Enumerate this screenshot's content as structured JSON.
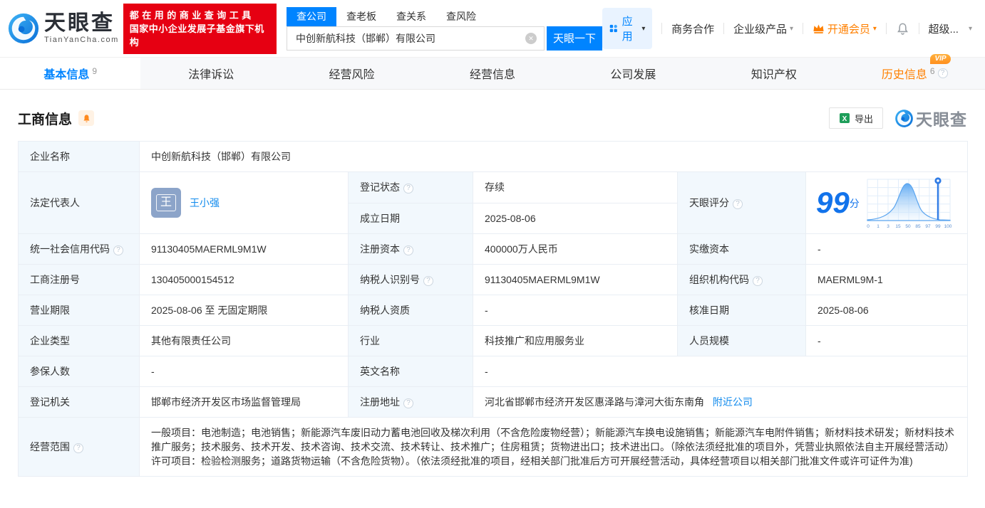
{
  "glyphs": {
    "caret": "▾",
    "clear": "✕",
    "help": "?"
  },
  "colors": {
    "brand_blue": "#0084ff",
    "banner_red": "#e60012",
    "status_green": "#00a971",
    "link_blue": "#128bed",
    "vip_orange": "#ff8000",
    "score_blue": "#1273eb"
  },
  "header": {
    "logo": {
      "brand": "天眼查",
      "domain": "TianYanCha.com"
    },
    "promo": {
      "line1": "都在用的商业查询工具",
      "line2": "国家中小企业发展子基金旗下机构"
    },
    "search": {
      "tabs": [
        {
          "label": "查公司",
          "active": true
        },
        {
          "label": "查老板",
          "active": false
        },
        {
          "label": "查关系",
          "active": false
        },
        {
          "label": "查风险",
          "active": false
        }
      ],
      "input_value": "中创新航科技（邯郸）有限公司",
      "button": "天眼一下"
    },
    "nav": {
      "apps": "应用",
      "cooperation": "商务合作",
      "enterprise": "企业级产品",
      "vip": "开通会员",
      "account": "超级..."
    }
  },
  "tabs": [
    {
      "label": "基本信息",
      "count": "9",
      "active": true
    },
    {
      "label": "法律诉讼"
    },
    {
      "label": "经营风险"
    },
    {
      "label": "经营信息"
    },
    {
      "label": "公司发展"
    },
    {
      "label": "知识产权"
    },
    {
      "label": "历史信息",
      "count": "6",
      "vip_badge": "VIP"
    }
  ],
  "section": {
    "title": "工商信息",
    "export_label": "导出",
    "watermark_brand": "天眼查"
  },
  "company": {
    "fields": {
      "name": {
        "label": "企业名称",
        "value": "中创新航科技（邯郸）有限公司"
      },
      "legal_rep": {
        "label": "法定代表人",
        "value": "王小强",
        "avatar_char": "王"
      },
      "reg_status": {
        "label": "登记状态",
        "value": "存续"
      },
      "establish_date": {
        "label": "成立日期",
        "value": "2025-08-06"
      },
      "credit_code": {
        "label": "统一社会信用代码",
        "value": "91130405MAERML9M1W"
      },
      "reg_capital": {
        "label": "注册资本",
        "value": "400000万人民币"
      },
      "paid_capital": {
        "label": "实缴资本",
        "value": "-"
      },
      "reg_number": {
        "label": "工商注册号",
        "value": "130405000154512"
      },
      "taxpayer_id": {
        "label": "纳税人识别号",
        "value": "91130405MAERML9M1W"
      },
      "org_code": {
        "label": "组织机构代码",
        "value": "MAERML9M-1"
      },
      "business_term": {
        "label": "营业期限",
        "value": "2025-08-06 至 无固定期限"
      },
      "taxpayer_quality": {
        "label": "纳税人资质",
        "value": "-"
      },
      "approval_date": {
        "label": "核准日期",
        "value": "2025-08-06"
      },
      "company_type": {
        "label": "企业类型",
        "value": "其他有限责任公司"
      },
      "industry": {
        "label": "行业",
        "value": "科技推广和应用服务业"
      },
      "staff_size": {
        "label": "人员规模",
        "value": "-"
      },
      "insured_count": {
        "label": "参保人数",
        "value": "-"
      },
      "english_name": {
        "label": "英文名称",
        "value": "-"
      },
      "reg_authority": {
        "label": "登记机关",
        "value": "邯郸市经济开发区市场监督管理局"
      },
      "address": {
        "label": "注册地址",
        "value": "河北省邯郸市经济开发区惠泽路与漳河大街东南角",
        "link": "附近公司"
      },
      "business_scope": {
        "label": "经营范围",
        "value": "一般项目：电池制造；电池销售；新能源汽车废旧动力蓄电池回收及梯次利用（不含危险废物经营）；新能源汽车换电设施销售；新能源汽车电附件销售；新材料技术研发；新材料技术推广服务；技术服务、技术开发、技术咨询、技术交流、技术转让、技术推广；住房租赁；货物进出口；技术进出口。（除依法须经批准的项目外，凭营业执照依法自主开展经营活动）许可项目：检验检测服务；道路货物运输（不含危险货物）。（依法须经批准的项目，经相关部门批准后方可开展经营活动，具体经营项目以相关部门批准文件或许可证件为准)"
      }
    },
    "score": {
      "label": "天眼评分",
      "value": "99",
      "unit": "分"
    }
  },
  "chart_data": {
    "type": "area",
    "title": "天眼评分分布曲线",
    "x_ticks": [
      "0",
      "1",
      "3",
      "15",
      "50",
      "85",
      "97",
      "99",
      "100"
    ],
    "marker_value": 99,
    "score": 99,
    "legend": [],
    "grid": true
  }
}
